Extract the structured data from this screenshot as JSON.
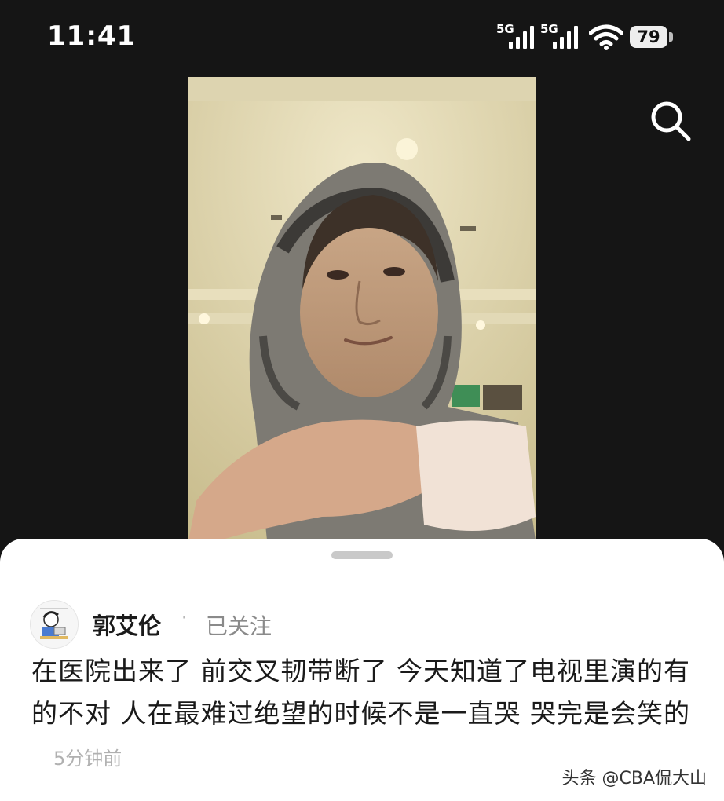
{
  "status_bar": {
    "time": "11:41",
    "network_1": "5G",
    "network_2": "5G",
    "battery": "79"
  },
  "toolbar": {
    "search_icon": "search-icon"
  },
  "post": {
    "author": "郭艾伦",
    "separator": "·",
    "follow_status": "已关注",
    "text": "在医院出来了 前交叉韧带断了 今天知道了电视里演的有的不对 人在最难过绝望的时候不是一直哭 哭完是会笑的",
    "time": "5分钟前"
  },
  "watermark": "头条 @CBA侃大山",
  "colors": {
    "background": "#151515",
    "sheet": "#ffffff",
    "text": "#1a1a1a",
    "muted": "#8a8a8a"
  }
}
